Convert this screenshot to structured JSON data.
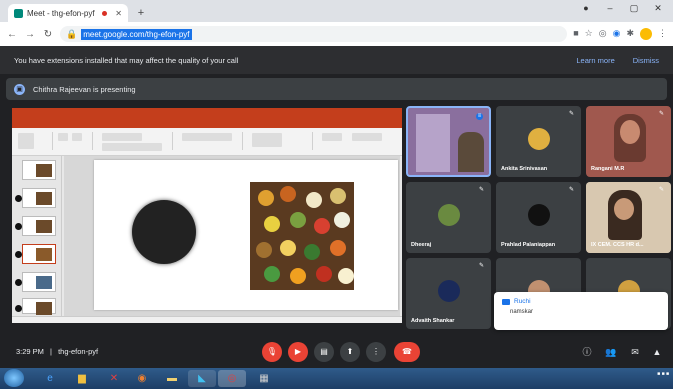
{
  "browser": {
    "tab_title": "Meet - thg-efon-pyf",
    "url": "meet.google.com/thg-efon-pyf"
  },
  "extension_bar": {
    "message": "You have extensions installed that may affect the quality of your call",
    "learn_more": "Learn more",
    "dismiss": "Dismiss"
  },
  "presenting_banner": {
    "text": "Chithra Rajeevan is presenting"
  },
  "participants": [
    {
      "name": "",
      "bg": "#8a6f9e"
    },
    {
      "name": "Ankita Srinivasan",
      "bg": "#3c4043"
    },
    {
      "name": "Rangani M.R",
      "bg": "#a0584e"
    },
    {
      "name": "Dheeraj",
      "bg": "#3c4043"
    },
    {
      "name": "Prahlad Palaniappan",
      "bg": "#3c4043"
    },
    {
      "name": "IX CEM. CCS HR d...",
      "bg": "#b0a395"
    },
    {
      "name": "Advaith Shankar",
      "bg": "#3c4043"
    },
    {
      "name": "",
      "bg": "#3c4043"
    },
    {
      "name": "",
      "bg": "#3c4043"
    }
  ],
  "chat_toast": {
    "sender": "Ruchi",
    "message": "namskar"
  },
  "bottom_bar": {
    "time": "3:29 PM",
    "separator": "|",
    "meeting_code": "thg-efon-pyf"
  },
  "colors": {
    "meet_bg": "#202124",
    "danger": "#ea4335",
    "ppt_accent": "#c43e1c",
    "link": "#8ab4f8"
  }
}
